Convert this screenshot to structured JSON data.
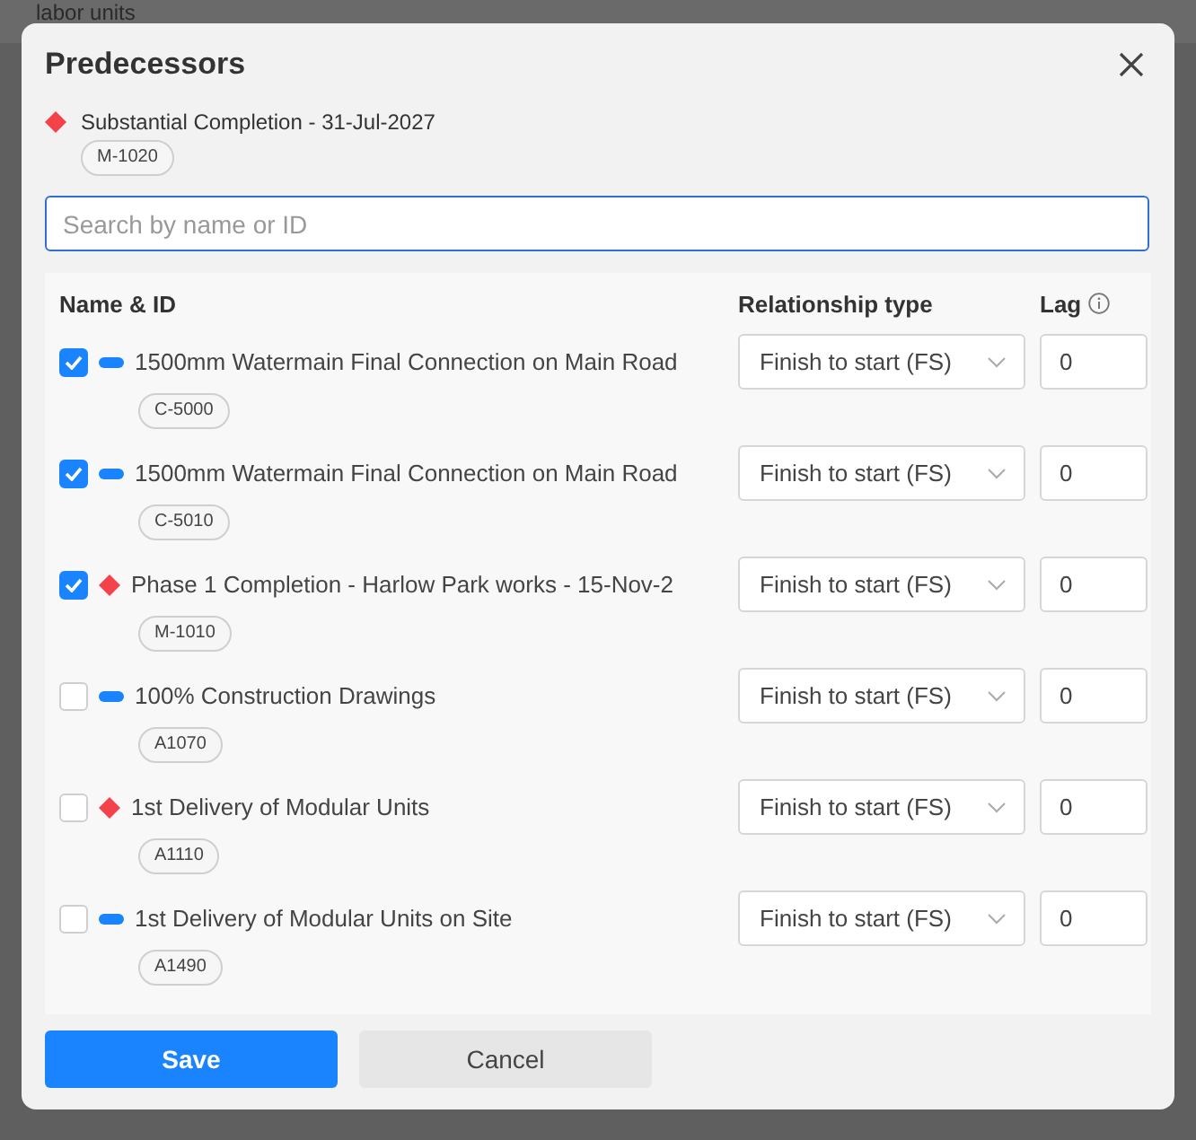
{
  "background": {
    "column_1": "labor units"
  },
  "dialog": {
    "title": "Predecessors",
    "activity": {
      "kind": "milestone",
      "name": "Substantial Completion - 31-Jul-2027",
      "id": "M-1020"
    },
    "search": {
      "placeholder": "Search by name or ID"
    },
    "columns": [
      "Name & ID",
      "Relationship type",
      "Lag"
    ],
    "rows": [
      {
        "checked": true,
        "kind": "task",
        "name": "1500mm Watermain Final Connection on Main Road",
        "id": "C-5000",
        "relationship": "Finish to start (FS)",
        "lag": "0"
      },
      {
        "checked": true,
        "kind": "task",
        "name": "1500mm Watermain Final Connection on Main Road",
        "id": "C-5010",
        "relationship": "Finish to start (FS)",
        "lag": "0"
      },
      {
        "checked": true,
        "kind": "milestone",
        "name": "Phase 1 Completion - Harlow Park works - 15-Nov-2",
        "id": "M-1010",
        "relationship": "Finish to start (FS)",
        "lag": "0"
      },
      {
        "checked": false,
        "kind": "task",
        "name": "100% Construction Drawings",
        "id": "A1070",
        "relationship": "Finish to start (FS)",
        "lag": "0"
      },
      {
        "checked": false,
        "kind": "milestone",
        "name": "1st Delivery of Modular Units",
        "id": "A1110",
        "relationship": "Finish to start (FS)",
        "lag": "0"
      },
      {
        "checked": false,
        "kind": "task",
        "name": "1st Delivery of Modular Units on Site",
        "id": "A1490",
        "relationship": "Finish to start (FS)",
        "lag": "0"
      }
    ],
    "buttons": [
      "Save",
      "Cancel"
    ]
  }
}
